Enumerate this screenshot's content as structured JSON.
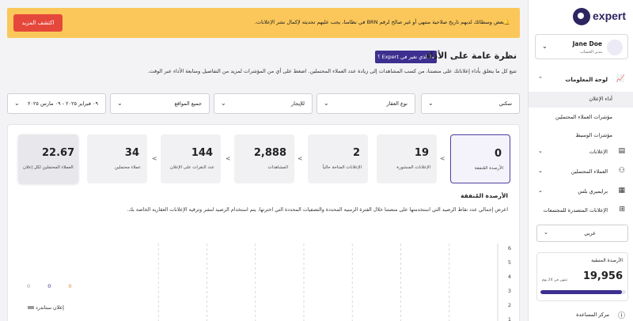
{
  "banner": {
    "text": "🔔بعض وسطائك لديهم تاريخ صلاحية منتهي أو غير صالح لرقم BRN في نظامنا، يجب عليهم تحديثه لإكمال نشر الإعلانات.",
    "button": "اكتشف المزيد",
    "color": "#fbc75a",
    "button_color": "#e5483b"
  },
  "header": {
    "whats_new": "ما الذي تغير في Expert ؟",
    "title": "نظرة عامة على الأداء",
    "subtitle": "تتبع كل ما يتعلق بأداء إعلاناتك على منصتنا، من كسب المشاهدات إلى زيادة عدد العملاء المحتملين. اضغط على أي من المؤشرات لمزيد من التفاصيل ومتابعة الأداء عبر الوقت."
  },
  "filters": [
    {
      "label": "سكني"
    },
    {
      "label": "نوع العقار"
    },
    {
      "label": "للإيجار"
    },
    {
      "label": "جميع المواقع"
    },
    {
      "label": "٠٩ فبراير ٢٠٢٥ - ٠٩ مارس ٢٠٢٥"
    }
  ],
  "kpis": [
    {
      "value": "0",
      "label": "الأرصدة المُنفقة"
    },
    {
      "value": "19",
      "label": "الإعلانات المنشورة"
    },
    {
      "value": "2",
      "label": "الإعلانات المتاحة حالياً"
    },
    {
      "value": "2,888",
      "label": "المشاهدات"
    },
    {
      "value": "144",
      "label": "عدد النقرات على الإعلان"
    },
    {
      "value": "34",
      "label": "عملاء محتملين"
    },
    {
      "value": "22.67",
      "label": "العملاء المحتملين لكل إعلان"
    }
  ],
  "section": {
    "title": "الأرصدة المُنفقة",
    "description": "اعرض إجمالي عدد نقاط الرصيد التي استخدمتها على منصتنا خلال الفترة الزمنية المحددة والتصفيات المحددة التي اخترتها. يتم استخدام الرصيد لنشر وترقية الإعلانات العقارية الخاصة بك."
  },
  "chart_data": {
    "type": "line",
    "y_ticks": [
      "6",
      "5",
      "4",
      "3",
      "2",
      "1"
    ],
    "legend_counts": [
      "0",
      "0",
      "0"
    ],
    "legend_colors": [
      "#999999",
      "#3c2f8f",
      "#e08a2e"
    ],
    "series": [
      {
        "name": "إعلان ستاندرد",
        "values": []
      }
    ]
  },
  "sidebar": {
    "brand": "expert",
    "user_name": "Jane Doe",
    "user_role": "مدير الحساب",
    "nav": [
      {
        "label": "لوحة المعلومات",
        "icon": "chart-icon"
      },
      {
        "label": "أداء الإعلان"
      },
      {
        "label": "مؤشرات العملاء المحتملين"
      },
      {
        "label": "مؤشرات الوسيط"
      },
      {
        "label": "الإعلانات",
        "icon": "listings-icon"
      },
      {
        "label": "العملاء المحتملين",
        "icon": "leads-icon"
      },
      {
        "label": "برايميري بلس",
        "icon": "building-icon"
      },
      {
        "label": "الإعلانات المتصدرة للمجتمعات",
        "icon": "grid-icon"
      }
    ],
    "language": "عربي",
    "credits": {
      "label": "الأرصدة المتبقية",
      "value": "19,956",
      "expiry": "تنتهي في 24 يوم",
      "fill_fraction": 0.95
    },
    "help": "مركز المساعدة"
  }
}
